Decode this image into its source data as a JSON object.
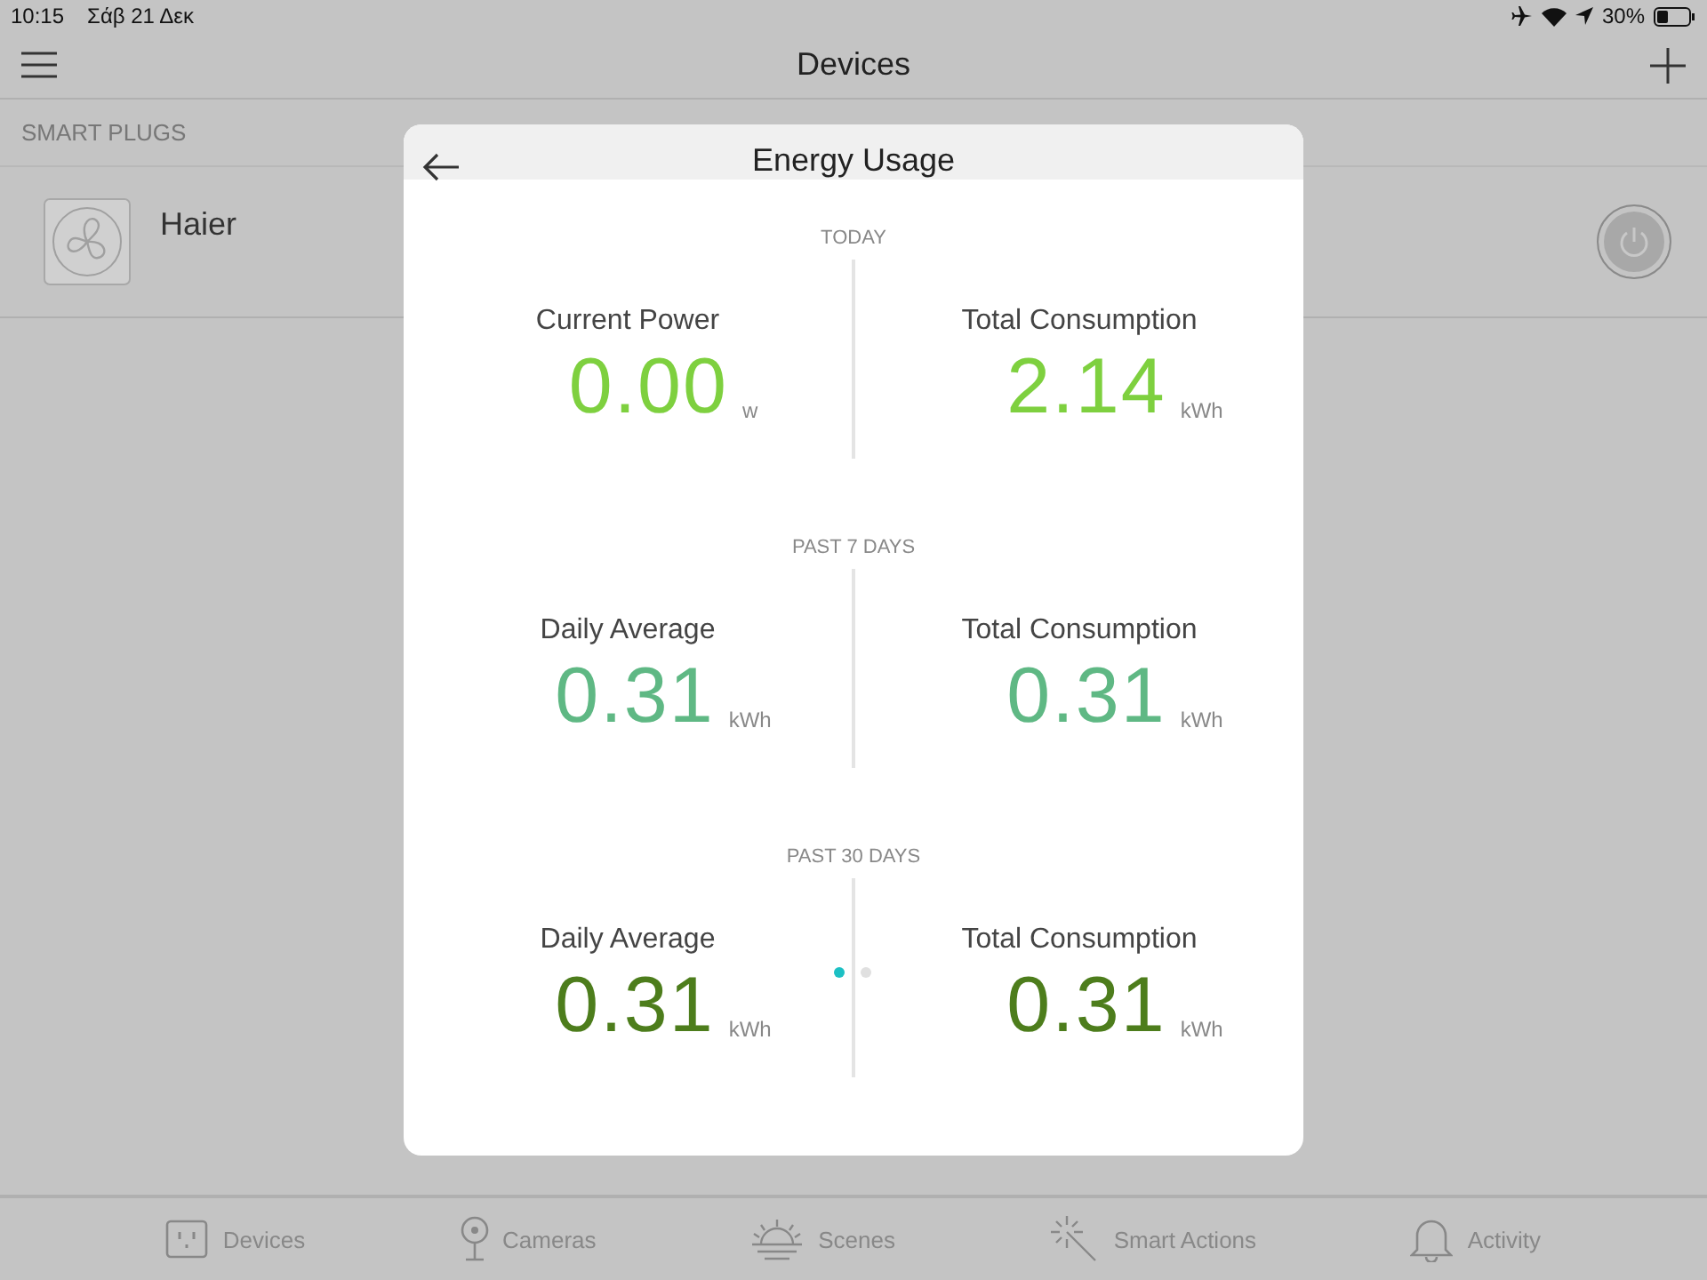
{
  "status_bar": {
    "time": "10:15",
    "date": "Σάβ 21 Δεκ",
    "battery": "30%"
  },
  "nav_bar": {
    "title": "Devices"
  },
  "section": {
    "title": "SMART PLUGS"
  },
  "devices": [
    {
      "name": "Haier",
      "on": false
    }
  ],
  "dialog": {
    "title": "Energy Usage",
    "sections": [
      {
        "title": "TODAY",
        "color": "#7ed03f",
        "stats": [
          {
            "label": "Current Power",
            "value": "0.00",
            "unit": "w"
          },
          {
            "label": "Total Consumption",
            "value": "2.14",
            "unit": "kWh"
          }
        ]
      },
      {
        "title": "PAST 7 DAYS",
        "color": "#5fb884",
        "stats": [
          {
            "label": "Daily Average",
            "value": "0.31",
            "unit": "kWh"
          },
          {
            "label": "Total Consumption",
            "value": "0.31",
            "unit": "kWh"
          }
        ]
      },
      {
        "title": "PAST 30 DAYS",
        "color": "#4d7d1c",
        "stats": [
          {
            "label": "Daily Average",
            "value": "0.31",
            "unit": "kWh"
          },
          {
            "label": "Total Consumption",
            "value": "0.31",
            "unit": "kWh"
          }
        ]
      }
    ],
    "pages": [
      {
        "selected": true
      },
      {
        "selected": false
      }
    ]
  },
  "tab_bar": [
    {
      "label": "Devices"
    },
    {
      "label": "Cameras"
    },
    {
      "label": "Scenes"
    },
    {
      "label": "Smart Actions"
    },
    {
      "label": "Activity"
    }
  ]
}
